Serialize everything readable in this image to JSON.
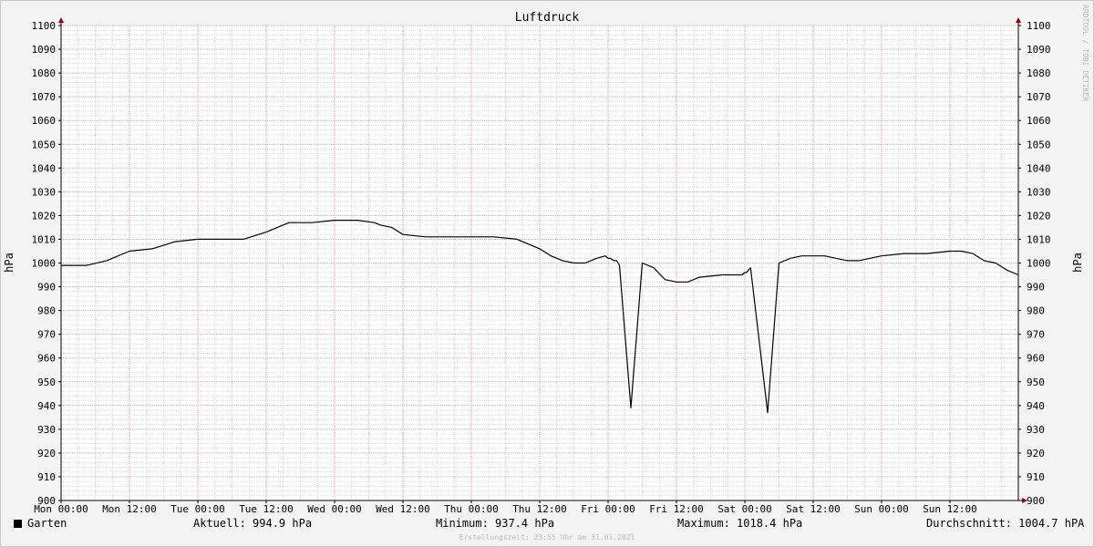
{
  "chart_data": {
    "type": "line",
    "title": "Luftdruck",
    "ylabel": "hPa",
    "ylabel_right": "hPa",
    "ylim": [
      900,
      1100
    ],
    "y_ticks": [
      900,
      910,
      920,
      930,
      940,
      950,
      960,
      970,
      980,
      990,
      1000,
      1010,
      1020,
      1030,
      1040,
      1050,
      1060,
      1070,
      1080,
      1090,
      1100
    ],
    "xlim_hours": [
      0,
      168
    ],
    "x_ticks": [
      {
        "h": 0,
        "label": "Mon 00:00"
      },
      {
        "h": 12,
        "label": "Mon 12:00"
      },
      {
        "h": 24,
        "label": "Tue 00:00"
      },
      {
        "h": 36,
        "label": "Tue 12:00"
      },
      {
        "h": 48,
        "label": "Wed 00:00"
      },
      {
        "h": 60,
        "label": "Wed 12:00"
      },
      {
        "h": 72,
        "label": "Thu 00:00"
      },
      {
        "h": 84,
        "label": "Thu 12:00"
      },
      {
        "h": 96,
        "label": "Fri 00:00"
      },
      {
        "h": 108,
        "label": "Fri 12:00"
      },
      {
        "h": 120,
        "label": "Sat 00:00"
      },
      {
        "h": 132,
        "label": "Sat 12:00"
      },
      {
        "h": 144,
        "label": "Sun 00:00"
      },
      {
        "h": 156,
        "label": "Sun 12:00"
      }
    ],
    "grid": true,
    "series": [
      {
        "name": "Garten",
        "color": "#000000",
        "x": [
          0,
          4.5,
          8,
          12,
          16,
          20,
          24,
          28,
          32,
          36,
          40,
          44,
          48,
          52,
          55,
          56,
          58,
          60,
          64,
          68,
          72,
          76,
          80,
          84,
          86,
          88,
          90,
          92,
          94,
          95.5,
          96,
          96.4,
          97,
          97.5,
          98,
          100,
          102,
          104,
          106,
          108,
          110,
          112,
          116,
          118,
          119.5,
          120,
          120.3,
          120.6,
          121,
          124,
          126,
          128,
          130,
          132,
          134,
          136,
          138,
          140,
          144,
          148,
          152,
          156,
          158,
          160,
          162,
          164,
          166,
          168
        ],
        "values": [
          999,
          999,
          1001,
          1005,
          1006,
          1009,
          1010,
          1010,
          1010,
          1013,
          1017,
          1017,
          1018,
          1018,
          1017,
          1016,
          1015,
          1012,
          1011,
          1011,
          1011,
          1011,
          1010,
          1006,
          1003,
          1001,
          1000,
          1000,
          1002,
          1003,
          1002,
          1002,
          1001,
          1001,
          999,
          939,
          1000,
          998,
          993,
          992,
          992,
          994,
          995,
          995,
          995,
          996,
          996,
          997,
          998,
          937,
          1000,
          1002,
          1003,
          1003,
          1003,
          1002,
          1001,
          1001,
          1003,
          1004,
          1004,
          1005,
          1005,
          1004,
          1001,
          1000,
          997,
          995
        ]
      }
    ]
  },
  "legend": {
    "series_name": "Garten",
    "aktuell": "Aktuell: 994.9 hPa",
    "minimum": "Minimum: 937.4 hPa",
    "maximum": "Maximum: 1018.4 hPa",
    "durchschnitt": "Durchschnitt: 1004.7 hPA"
  },
  "side_text": "RRDTOOL / TOBI OETIKER",
  "footer": "Erstellungszeit: 23:55 Uhr am 31.01.2021",
  "colors": {
    "background": "#f3f3f3",
    "canvas": "#ffffff",
    "minor_grid": "#dcdcdc",
    "major_grid": "#e5a4a4",
    "axis": "#000000",
    "arrow": "#a00000",
    "line": "#000000"
  }
}
